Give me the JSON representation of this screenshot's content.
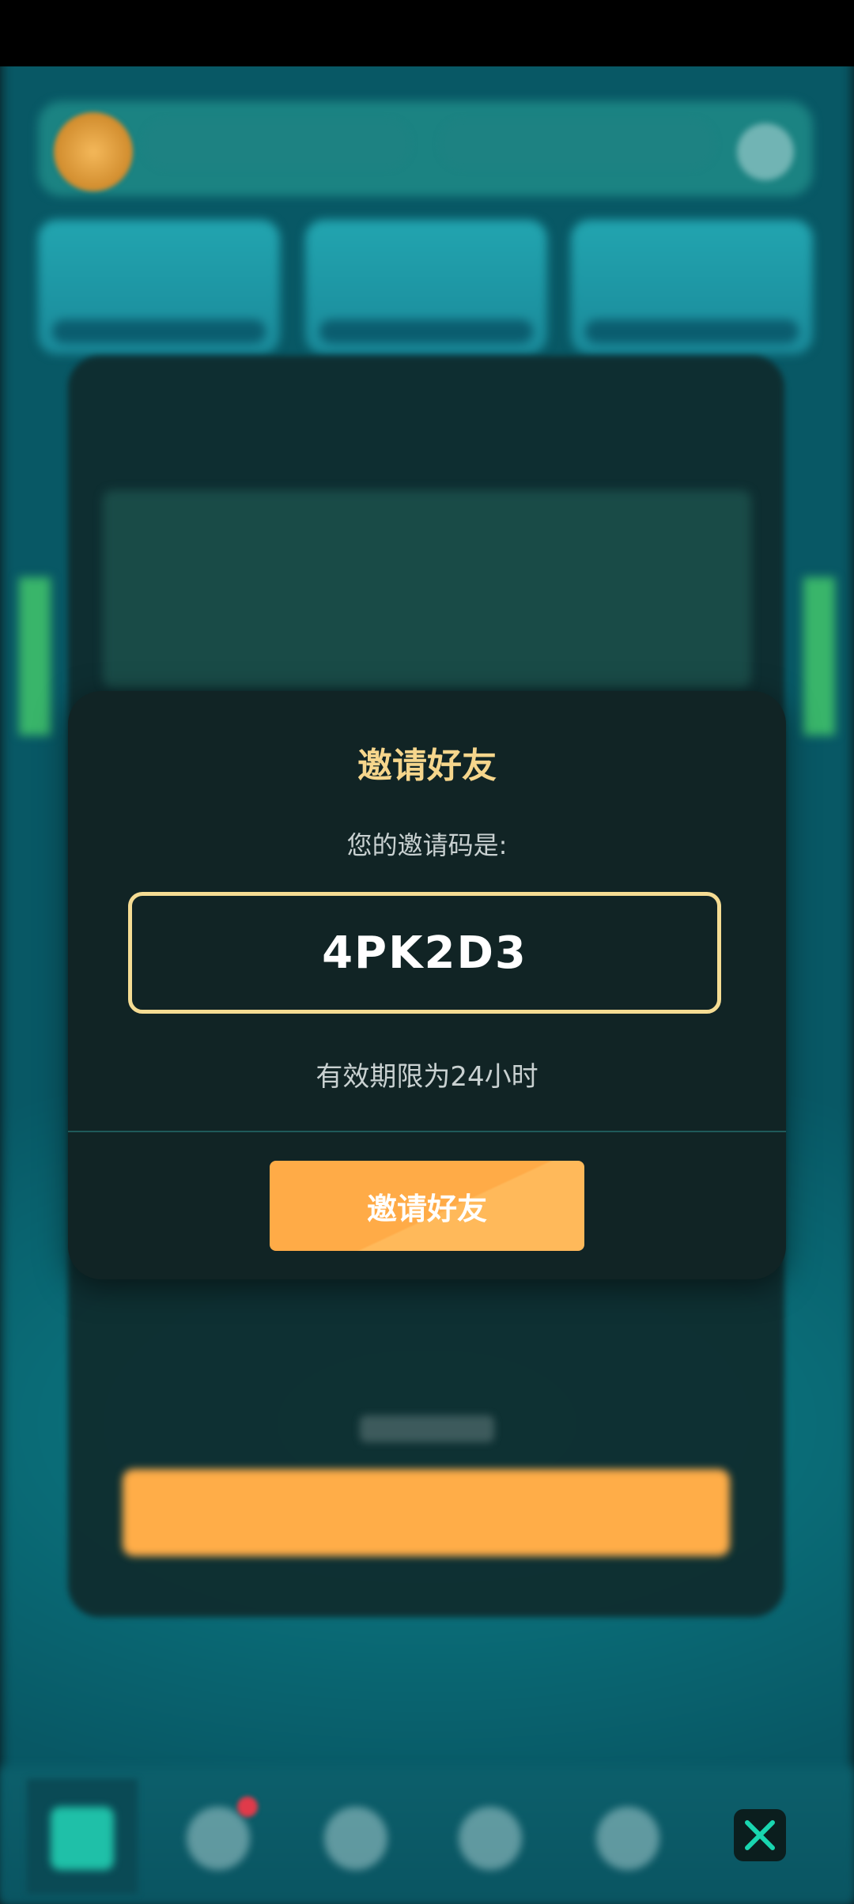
{
  "modal": {
    "title": "邀请好友",
    "subtitle": "您的邀请码是:",
    "invite_code": "4PK2D3",
    "validity": "有效期限为24小时",
    "invite_button": "邀请好友"
  },
  "colors": {
    "accent_gold": "#f6d68c",
    "button_orange": "#ffab47",
    "modal_bg": "#112425"
  },
  "icons": {
    "close": "close-x-icon",
    "settings": "gear-icon"
  }
}
